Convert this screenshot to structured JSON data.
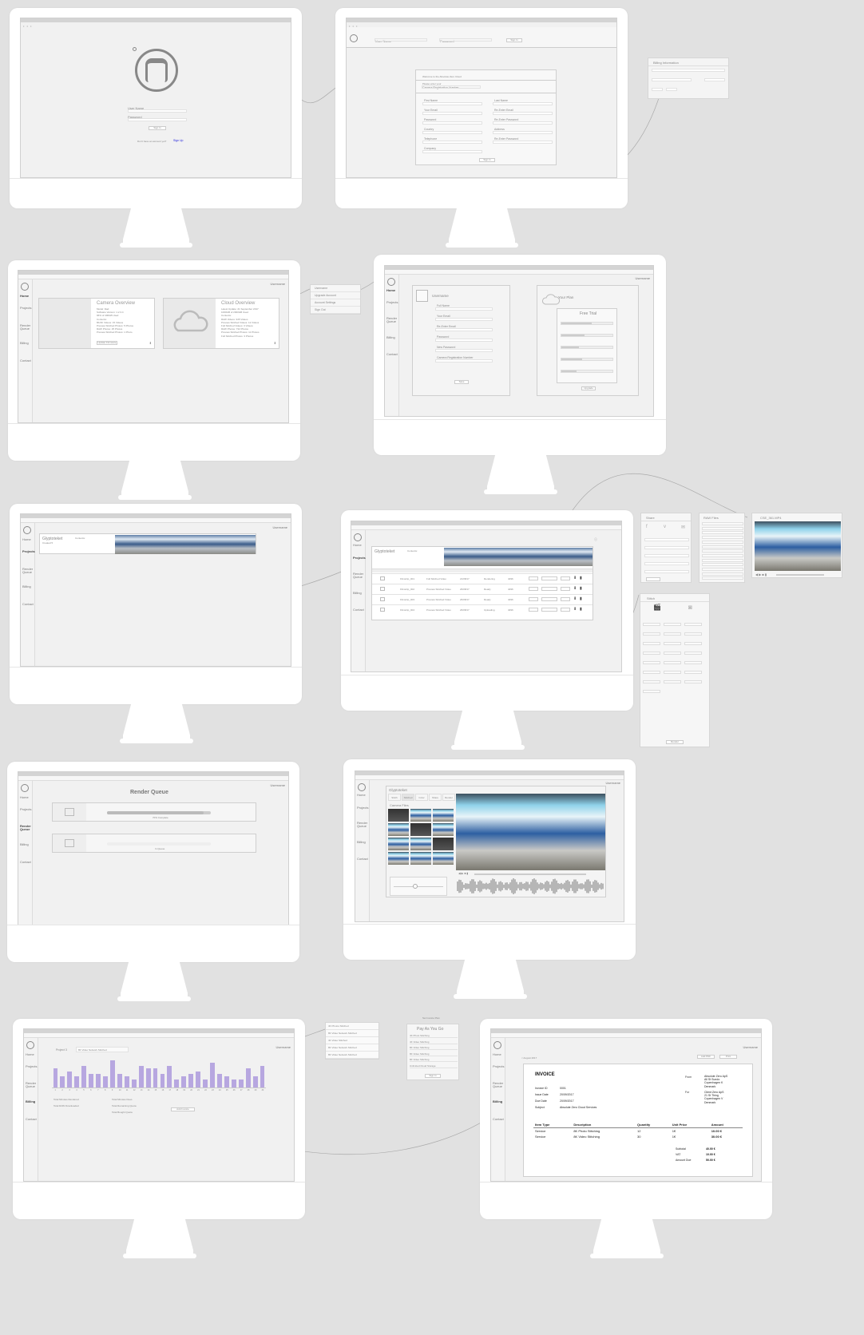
{
  "m1": {
    "username_label": "User Name",
    "password_label": "Password",
    "signin": "Sign In",
    "signup_prompt": "Don't have an account yet?",
    "signup_link": "Sign Up"
  },
  "m2": {
    "username": "User Name",
    "password": "Password",
    "signin": "Sign In",
    "welcome": "Welcome to the Absolute Zero Cloud",
    "first_entry": "Please enter your",
    "camera_reg": "Camera Registration Number",
    "first_name": "First Name",
    "last_name": "Last Name",
    "email": "Your Email",
    "re_email": "Re-Enter Email",
    "password_f": "Password",
    "re_password": "Re-Enter Password",
    "country": "Country",
    "address": "Address",
    "telephone": "Telephone",
    "re_password2": "Re-Enter Password",
    "company": "Company",
    "submit": "Sign In"
  },
  "billing_popup": {
    "title": "Billing Information"
  },
  "nav": {
    "home": "Home",
    "projects": "Projects",
    "render_queue": "Render Queue",
    "billing": "Billing",
    "contact": "Contact",
    "username": "Username"
  },
  "m3": {
    "camera_overview": "Camera Overview",
    "camera_lines": [
      "Model: Iliad",
      "Software Version: 1.2.3.4",
      "96% of 400GB Used",
      "Contents:",
      "8K/4K Videos: 15 Videos",
      "Preview Stitched Photos: 5 Photos",
      "RAW Photos: 25 Photos",
      "Preview Stitched Photos: 1 Photo"
    ],
    "update_firmware": "Update Firmware",
    "cloud_overview": "Cloud Overview",
    "cloud_lines": [
      "Latest Update: 21 September 2017",
      "1000GB of 2000GB Used",
      "Contents:",
      "RAW Videos: 345 Videos",
      "Preview Stitched Videos: 12 Videos",
      "Full Stitched Videos: 3 Videos",
      "RAW Photos: 732 Photos",
      "Preview Stitched Photos: 11 Photos",
      "Full Stitched Photos: 3 Photos"
    ]
  },
  "dropdown": {
    "items": [
      "Username",
      "Upgrade Account",
      "Account Settings",
      "Sign Out"
    ]
  },
  "m4": {
    "username": "Username",
    "full_name": "Full Name",
    "email": "Your Email",
    "re_email": "Re-Enter Email",
    "password": "Password",
    "new_password": "New Password",
    "camera_reg": "Camera Registration Number",
    "save": "Save",
    "your_plan": "Your Plan",
    "free_trial": "Free Trial",
    "upgrade": "Upgrade"
  },
  "m5": {
    "project": "Glyptoteket",
    "created": "Created 5",
    "contents": "Contents:"
  },
  "m6": {
    "project": "Glyptoteket",
    "rows": [
      {
        "name": "Filmstrip_001",
        "type": "Full Stitched Video",
        "date": "21/08/17",
        "status": "Rendering",
        "res": "4096"
      },
      {
        "name": "Filmstrip_002",
        "type": "Preview Stitched Video",
        "date": "26/08/17",
        "status": "Ready",
        "res": "4096"
      },
      {
        "name": "Filmstrip_003",
        "type": "Preview Stitched Video",
        "date": "26/08/17",
        "status": "Ready",
        "res": "4096"
      },
      {
        "name": "Filmstrip_004",
        "type": "Preview Stitched Video",
        "date": "26/08/17",
        "status": "Uploading",
        "res": "4096"
      }
    ]
  },
  "share": {
    "title": "Share"
  },
  "raw_files": {
    "title": "RAW Files"
  },
  "video": {
    "title": "CSE_361.MP4"
  },
  "stitch": {
    "title": "Stitch",
    "render": "Render"
  },
  "m7": {
    "title": "Render Queue",
    "progress1": "70% Complete",
    "progress2": "In Queue"
  },
  "m8": {
    "project": "Glyptoteket",
    "camera_files": "Camera Files",
    "tabs": [
      "Stitch",
      "Stitched",
      "Color",
      "Share",
      "Render"
    ]
  },
  "m9": {
    "project_label": "Project 3",
    "select": "8K Video Network Stitched",
    "axis": [
      "1",
      "2",
      "3",
      "4",
      "5",
      "6",
      "7",
      "8",
      "9",
      "10",
      "11",
      "12",
      "13",
      "14",
      "15",
      "16",
      "17",
      "18",
      "19",
      "20",
      "21",
      "22",
      "23",
      "24",
      "25",
      "26",
      "27",
      "28",
      "29",
      "30"
    ],
    "values": [
      7,
      4,
      6,
      4,
      8,
      5,
      5,
      4,
      10,
      5,
      4,
      3,
      8,
      7,
      7,
      5,
      8,
      3,
      4,
      5,
      6,
      3,
      9,
      5,
      4,
      3,
      3,
      7,
      4,
      8
    ],
    "stats_left": [
      "Total Minutes Rendered",
      "Total RAW Downloaded"
    ],
    "stats_right": [
      "Total Minutes Dues",
      "Total Remaining Quota",
      "Total Bought Quota"
    ],
    "download": "Add Invoice"
  },
  "projects_dropdown": {
    "items": [
      "4K Photos Stitched",
      "8K Video Network Stitched",
      "4K Video Stitched",
      "8K Video Network Stitched",
      "8K Video Network Stitched"
    ]
  },
  "paygo": {
    "subtitle": "Set Invoice Plan",
    "title": "Pay As You Go",
    "rows": [
      "4K Photo Stitching",
      "4K Video Stitching",
      "8K Video Stitching",
      "8K Video Stitching",
      "8K Video Stitching",
      "Unlimited Cloud Storage"
    ],
    "button": "Sign In"
  },
  "invoice": {
    "crumb": "< August 2017",
    "add_pdf": "Add PDF",
    "print": "Print",
    "title": "INVOICE",
    "from": "From",
    "from_lines": [
      "Absolute Zero ApS",
      "All St Sundo",
      "Copenhagen K",
      "Denmark"
    ],
    "for": "For",
    "for_lines": [
      "Client Zero ApS",
      "21 St Thing",
      "Copenhagen V",
      "Denmark"
    ],
    "meta_labels": [
      "Invoice ID",
      "Issue Date",
      "Due Date",
      "Subject"
    ],
    "meta_values": [
      "0001",
      "20/09/2017",
      "20/09/2017",
      "Absolute Zero Cloud Services"
    ],
    "cols": [
      "Item Type",
      "Description",
      "Quantity",
      "Unit Price",
      "Amount"
    ],
    "items": [
      {
        "type": "Service",
        "desc": "8K Photo Stitching",
        "qty": "12",
        "unit": "1€",
        "amount": "10.00 €"
      },
      {
        "type": "Service",
        "desc": "8K Video Stitching",
        "qty": "30",
        "unit": "1€",
        "amount": "30.00 €"
      }
    ],
    "totals_labels": [
      "Subtotal",
      "VAT",
      "Amount Due"
    ],
    "totals": [
      "40.00 €",
      "10.00 €",
      "50.00 €"
    ]
  }
}
